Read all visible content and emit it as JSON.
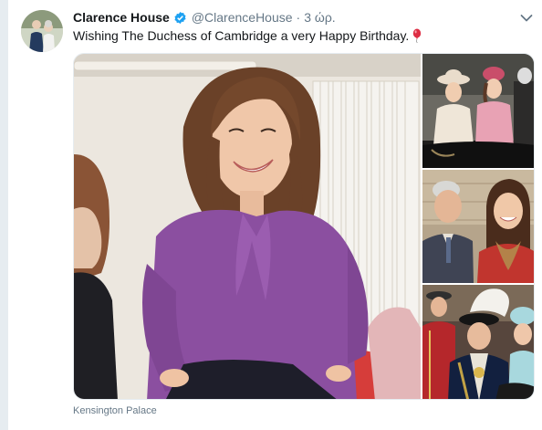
{
  "tweet": {
    "display_name": "Clarence House",
    "handle": "@ClarenceHouse",
    "separator": "·",
    "time": "3 ώρ.",
    "text": "Wishing The Duchess of Cambridge a very Happy Birthday.",
    "media_caption": "Kensington Palace"
  },
  "icons": {
    "verified": "verified-badge-icon",
    "more": "chevron-down-icon",
    "emoji": "balloon-emoji-icon"
  },
  "colors": {
    "accent": "#1da1f2",
    "text_primary": "#14171a",
    "text_secondary": "#657786",
    "page_background": "#e6ecf0"
  }
}
